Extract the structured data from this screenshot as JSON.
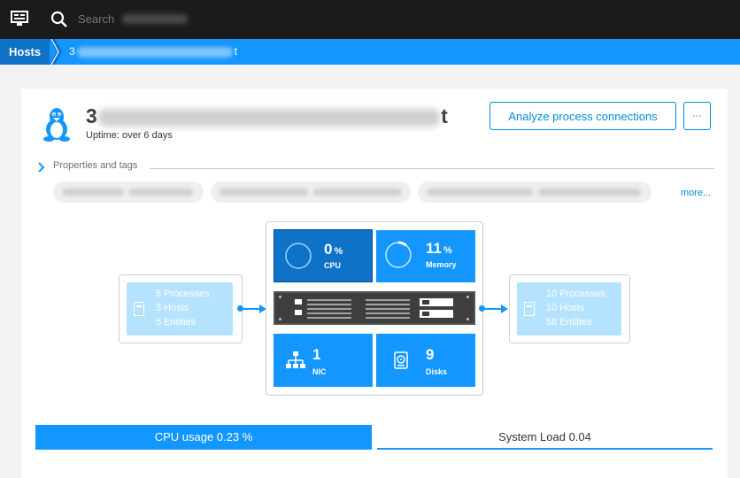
{
  "topbar": {
    "menu_icon": "monitor-icon",
    "search_icon": "search-icon",
    "search_placeholder": "Search"
  },
  "breadcrumb": {
    "root": "Hosts",
    "host_prefix": "3",
    "host_suffix": "t"
  },
  "host": {
    "icon": "linux-tux-icon",
    "name_prefix": "3",
    "name_suffix": "t",
    "uptime": "Uptime: over 6 days"
  },
  "actions": {
    "analyze": "Analyze process connections",
    "more": "···"
  },
  "properties": {
    "label": "Properties and tags",
    "more_link": "more..."
  },
  "diagram": {
    "left": {
      "processes": "5 Processes",
      "hosts": "3 Hosts",
      "entities": "5 Entities"
    },
    "right": {
      "processes": "10 Processes",
      "hosts": "10 Hosts",
      "entities": "58 Entities"
    },
    "cpu": {
      "value": "0",
      "unit": "%",
      "label": "CPU",
      "fraction": 0.0
    },
    "memory": {
      "value": "11",
      "unit": "%",
      "label": "Memory",
      "fraction": 0.11
    },
    "nic": {
      "value": "1",
      "label": "NIC",
      "icon": "network-icon"
    },
    "disks": {
      "value": "9",
      "label": "Disks",
      "icon": "disk-icon"
    }
  },
  "tabs": {
    "cpu_usage": "CPU usage 0.23 %",
    "system_load": "System Load 0.04"
  },
  "colors": {
    "accent": "#1496ff",
    "accent_dark": "#0e73c8",
    "link": "#008cdb",
    "topbar": "#1b1b1b"
  }
}
